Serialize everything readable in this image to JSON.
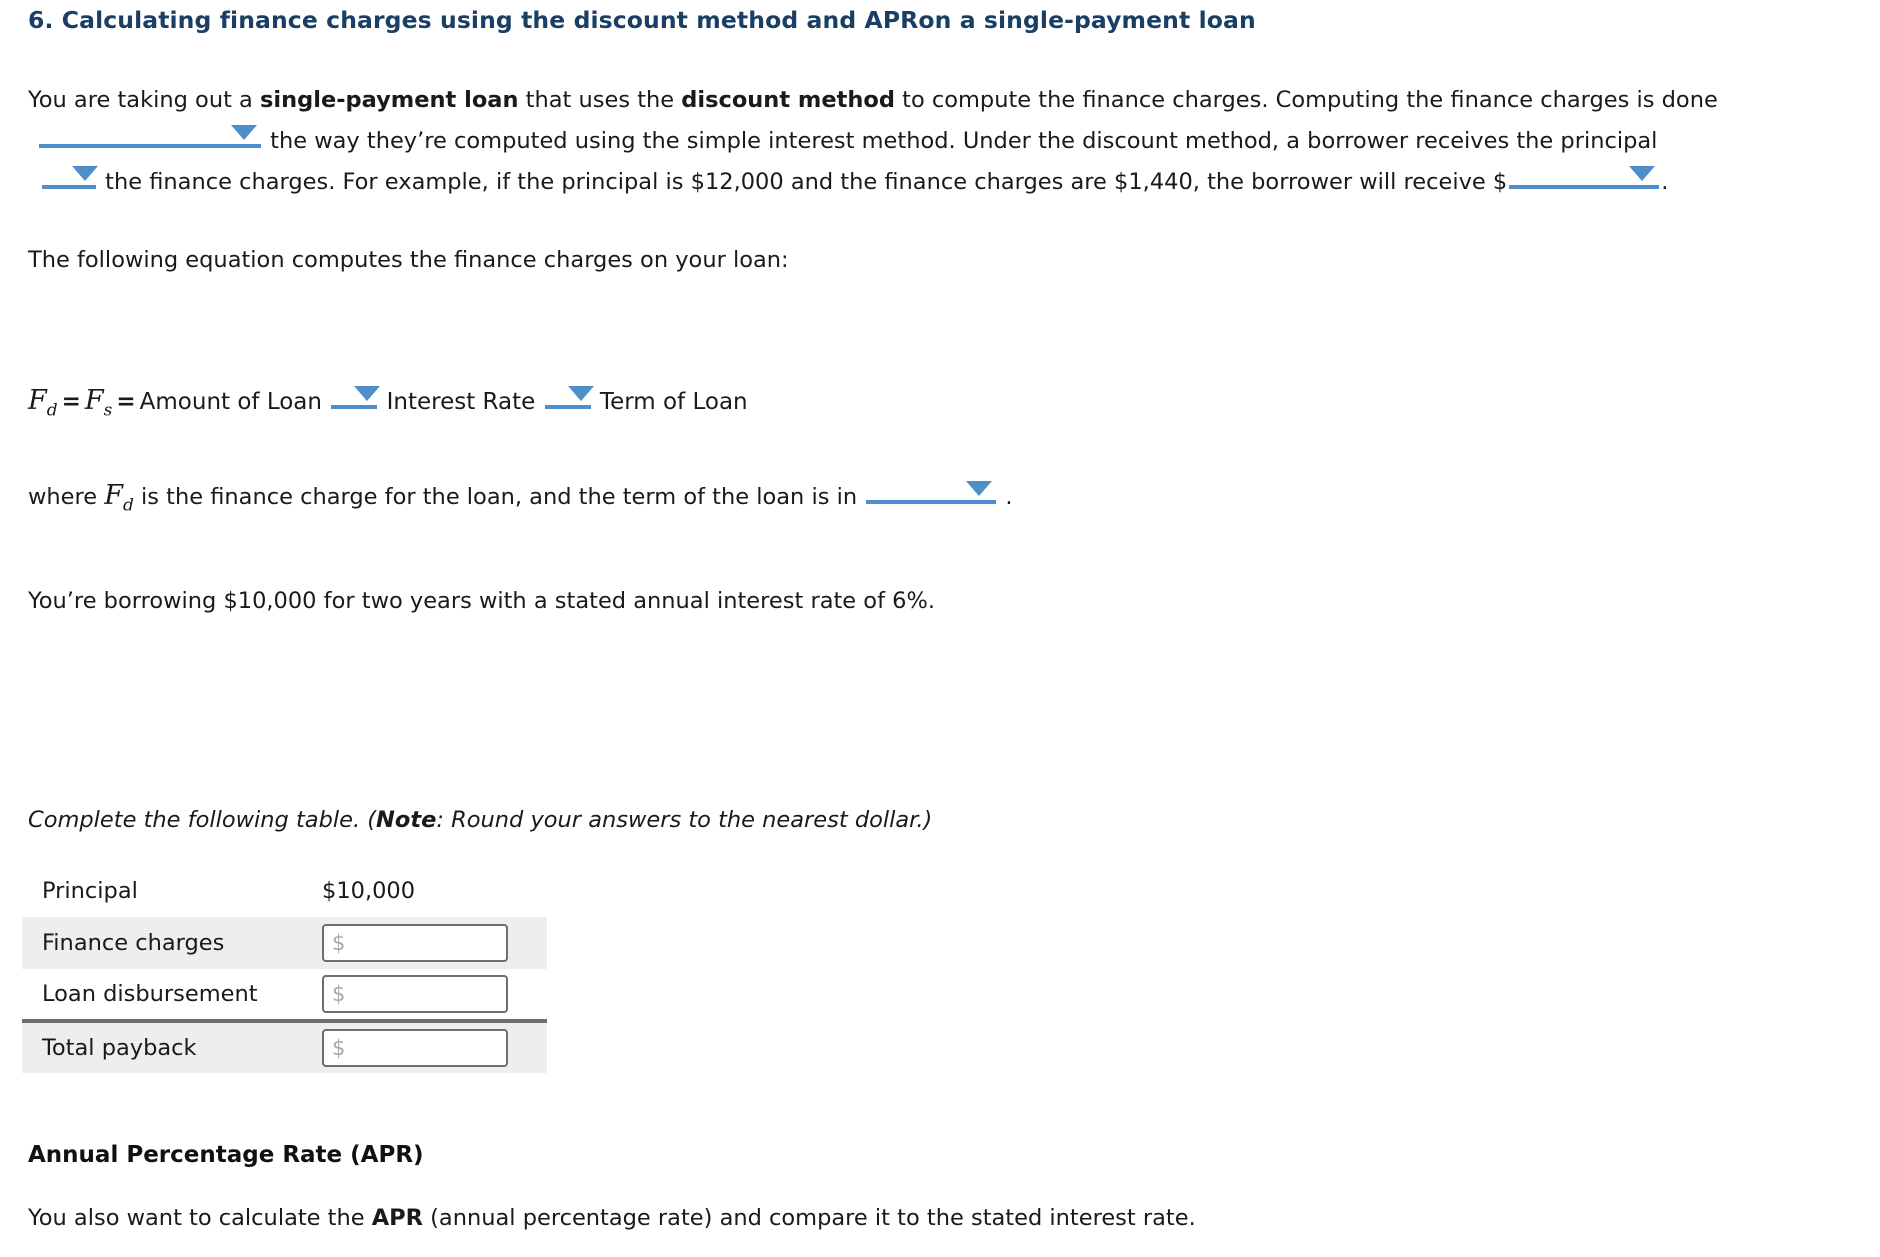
{
  "question": {
    "number": "6.",
    "title": "6. Calculating finance charges using the discount method and APRon a single-payment loan"
  },
  "intro": {
    "seg1": "You are taking out a ",
    "bold1": "single-payment loan",
    "seg2": " that uses the ",
    "bold2": "discount method",
    "seg3": " to compute the finance charges. Computing the finance charges is done",
    "seg4": " the way they’re computed using the simple interest method. Under the discount method, a borrower receives the principal",
    "seg5": " the finance charges. For example, if the principal is $12,000 and the finance charges are $1,440, the borrower will receive $",
    "seg6": "."
  },
  "equation_intro": "The following equation computes the finance charges on your loan:",
  "equation": {
    "fd": "F",
    "fd_sub": "d",
    "equals1": "=",
    "fs": "F",
    "fs_sub": "s",
    "equals2": "=",
    "term1": "Amount of Loan",
    "term2": "Interest Rate",
    "term3": "Term of Loan"
  },
  "where_line": {
    "seg1": "where ",
    "var": "F",
    "var_sub": "d",
    "seg2": " is the finance charge for the loan, and the term of the loan is in",
    "seg3": "."
  },
  "scenario": "You’re borrowing $10,000 for two years with a stated annual interest rate of 6%.",
  "table_instruction": {
    "seg1": "Complete the following table. (",
    "bold": "Note",
    "seg2": ": Round your answers to the nearest dollar.)"
  },
  "table": {
    "rows": [
      {
        "label": "Principal",
        "value": "$10,000",
        "input": false,
        "shaded": false,
        "separator": false
      },
      {
        "label": "Finance charges",
        "value": "",
        "input": true,
        "placeholder": "$",
        "shaded": true,
        "separator": false
      },
      {
        "label": "Loan disbursement",
        "value": "",
        "input": true,
        "placeholder": "$",
        "shaded": false,
        "separator": false
      },
      {
        "label": "Total payback",
        "value": "",
        "input": true,
        "placeholder": "$",
        "shaded": true,
        "separator": true
      }
    ]
  },
  "apr": {
    "heading": "Annual Percentage Rate (APR)",
    "seg1": "You also want to calculate the ",
    "bold": "APR",
    "seg2": " (annual percentage rate) and compare it to the stated interest rate."
  },
  "dropdowns": {
    "comparison_method": {
      "name": "comparison-method-dropdown",
      "value": ""
    },
    "principal_relation": {
      "name": "principal-relation-dropdown",
      "value": ""
    },
    "receive_amount": {
      "name": "receive-amount-dropdown",
      "value": ""
    },
    "equation_op1": {
      "name": "equation-operator-1-dropdown",
      "value": ""
    },
    "equation_op2": {
      "name": "equation-operator-2-dropdown",
      "value": ""
    },
    "term_units": {
      "name": "term-units-dropdown",
      "value": ""
    }
  },
  "colors": {
    "title_blue": "#1b3e64",
    "dropdown_blue": "#4e8fc9",
    "row_shade": "#eeeeee",
    "separator_gray": "#6e6e6e",
    "input_border": "#6e6e6e",
    "placeholder_gray": "#a8a8a8"
  }
}
